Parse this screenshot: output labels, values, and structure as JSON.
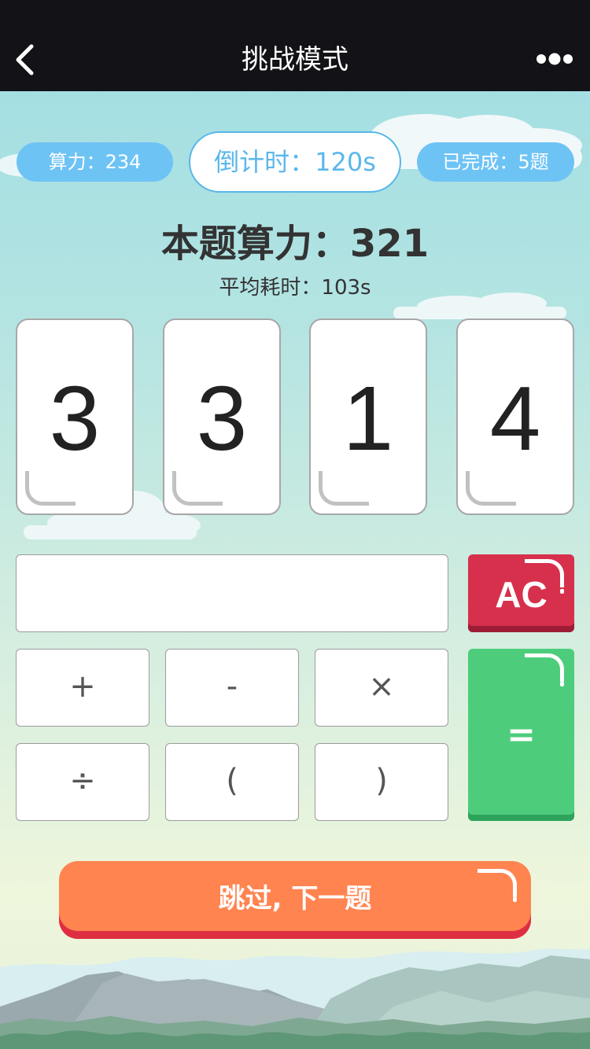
{
  "header": {
    "title": "挑战模式",
    "back_icon": "chevron-left-icon",
    "more_icon": "more-dots-icon"
  },
  "stats": {
    "power_label": "算力：234",
    "countdown_label": "倒计时：120s",
    "completed_label": "已完成：5题"
  },
  "question": {
    "power_label": "本题算力：321",
    "avg_time_label": "平均耗时：103s"
  },
  "cards": [
    "3",
    "3",
    "1",
    "4"
  ],
  "calculator": {
    "display_value": "",
    "clear_label": "AC",
    "equals_label": "=",
    "keys": [
      "+",
      "-",
      "×",
      "÷",
      "(",
      ")"
    ]
  },
  "skip_button_label": "跳过, 下一题",
  "colors": {
    "header_bg": "#121217",
    "pill_blue": "#6ec3f5",
    "clear_red": "#d7304c",
    "equals_green": "#4dcd7c",
    "skip_orange": "#ff8450"
  }
}
